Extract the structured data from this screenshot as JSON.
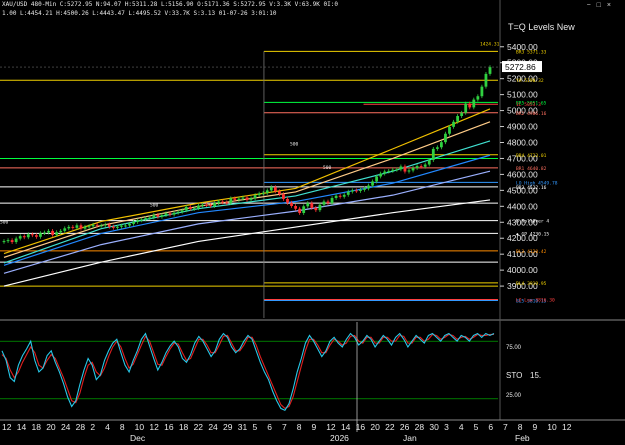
{
  "header": {
    "line1": "XAU/USD 480-Min  C:5272.95 N:94.07 H:5311.28 L:5156.90 O:5171.36 S:5272.95 V:3.3K V:63.9K 0I:0",
    "line2": "1.00  L:4454.21 H:4500.26 L:4443.47 L:4495.52 V:33.7K S:3.13 01-07-26 3:01:10"
  },
  "window_icons": [
    "minimize-icon",
    "restore-icon",
    "close-icon"
  ],
  "colors": {
    "background": "#000000",
    "price_box": "#ffffff",
    "level_resistance": "#ff7060",
    "level_support": "#3399ff",
    "osc_fast": "#27c8e8",
    "osc_slow": "#e02020"
  },
  "chart_data": {
    "type": "line",
    "title": "T=Q Levels New",
    "symbol": "XAU/USD",
    "interval": "480-Min",
    "last_price": 5272.95,
    "last_price_label": "5272.86",
    "ylim": [
      3700,
      5480
    ],
    "y_ticks": [
      3900,
      4000,
      4100,
      4200,
      4300,
      4400,
      4500,
      4600,
      4700,
      4800,
      4900,
      5000,
      5100,
      5200,
      5300,
      5400
    ],
    "y_tick_labels": [
      "3900.00",
      "4000.00",
      "4100.00",
      "4200.00",
      "4300.00",
      "4400.00",
      "4500.00",
      "4600.00",
      "4700.00",
      "4800.00",
      "4900.00",
      "5000.00",
      "5100.00",
      "5200.00",
      "5300.00",
      "5400.00"
    ],
    "x_tick_labels": [
      "12",
      "14",
      "18",
      "20",
      "24",
      "28",
      "2",
      "4",
      "8",
      "10",
      "12",
      "16",
      "18",
      "22",
      "24",
      "29",
      "31",
      "5",
      "6",
      "7",
      "8",
      "9",
      "12",
      "14",
      "16",
      "20",
      "22",
      "26",
      "28",
      "30",
      "3",
      "4",
      "5",
      "6",
      "7",
      "8",
      "9",
      "10",
      "12"
    ],
    "x_months": [
      "Dec",
      "2026",
      "Jan",
      "Feb"
    ],
    "price_close": [
      4182,
      4188,
      4176,
      4198,
      4213,
      4206,
      4225,
      4219,
      4209,
      4232,
      4236,
      4246,
      4221,
      4238,
      4246,
      4262,
      4271,
      4265,
      4281,
      4260,
      4272,
      4275,
      4284,
      4278,
      4280,
      4286,
      4272,
      4265,
      4272,
      4279,
      4280,
      4290,
      4302,
      4312,
      4318,
      4326,
      4330,
      4346,
      4335,
      4345,
      4356,
      4348,
      4360,
      4366,
      4375,
      4396,
      4384,
      4388,
      4405,
      4410,
      4408,
      4402,
      4420,
      4430,
      4425,
      4420,
      4450,
      4440,
      4448,
      4455,
      4440,
      4450,
      4470,
      4480,
      4484,
      4500,
      4520,
      4494,
      4476,
      4446,
      4422,
      4402,
      4385,
      4358,
      4400,
      4420,
      4390,
      4376,
      4410,
      4430,
      4420,
      4452,
      4466,
      4460,
      4472,
      4492,
      4500,
      4496,
      4503,
      4512,
      4530,
      4556,
      4587,
      4605,
      4618,
      4622,
      4629,
      4632,
      4650,
      4618,
      4625,
      4640,
      4652,
      4648,
      4662,
      4690,
      4760,
      4770,
      4802,
      4855,
      4898,
      4930,
      4966,
      4986,
      5044,
      5020,
      5069,
      5090,
      5150,
      5230,
      5272
    ],
    "moving_averages": [
      {
        "color": "#f0c000",
        "values": [
          4104,
          4305,
          4420,
          4512,
          4760,
          5010
        ]
      },
      {
        "color": "#ffcc88",
        "values": [
          4080,
          4280,
          4400,
          4490,
          4700,
          4930
        ]
      },
      {
        "color": "#40e0d0",
        "values": [
          4045,
          4260,
          4385,
          4465,
          4620,
          4810
        ]
      },
      {
        "color": "#2288ff",
        "values": [
          4030,
          4230,
          4360,
          4430,
          4545,
          4720
        ]
      },
      {
        "color": "#9bb0ff",
        "values": [
          3980,
          4160,
          4290,
          4370,
          4470,
          4620
        ]
      },
      {
        "color": "#ffffff",
        "values": [
          3900,
          4050,
          4180,
          4270,
          4360,
          4440
        ]
      }
    ],
    "levels": [
      {
        "label": "BR3 5371.33",
        "value": 5371.33,
        "color": "#f0d000",
        "start": 0.53
      },
      {
        "label": "YH 5190.32",
        "value": 5190.32,
        "color": "#f0d000",
        "start": 0.0
      },
      {
        "label": "BR5 5051.65",
        "value": 5051.65,
        "color": "#00ff40",
        "start": 0.53
      },
      {
        "label": "1L 5053.3",
        "value": 5040,
        "color": "#ff4040",
        "start": 0.73
      },
      {
        "label": "BR2 4986.16",
        "value": 4986.16,
        "color": "#ff7060",
        "start": 0.53
      },
      {
        "label": "BR4 4723.01",
        "value": 4723.01,
        "color": "#f0d000",
        "start": 0.53
      },
      {
        "label": "BR1 4640.82",
        "value": 4640.82,
        "color": "#ff7060",
        "start": 0.0
      },
      {
        "label": "LO High 4549.78",
        "value": 4549.78,
        "color": "#3399ff",
        "start": 0.53
      },
      {
        "label": "BR3 4522.16",
        "value": 4522.16,
        "color": "#ffffff",
        "start": 0.0
      },
      {
        "label": "",
        "value": 4420,
        "color": "#ffffff",
        "start": 0.0
      },
      {
        "label": "B RollOver 4",
        "value": 4310,
        "color": "#ffffff",
        "start": 0.0
      },
      {
        "label": "◆ GP 4230.15",
        "value": 4230.15,
        "color": "#ffffff",
        "start": 0.0
      },
      {
        "label": "BL3 4120.42",
        "value": 4120.42,
        "color": "#ff8c00",
        "start": 0.0
      },
      {
        "label": "",
        "value": 4050,
        "color": "#ffffff",
        "start": 0.0
      },
      {
        "label": "BL4 3919.95",
        "value": 3919.95,
        "color": "#f0d000",
        "start": 0.53
      },
      {
        "label": "BL5 3810.15",
        "value": 3810,
        "color": "#3399ff",
        "start": 0.53
      },
      {
        "label": "LO Low 3816.30",
        "value": 3816.3,
        "color": "#ff4040",
        "start": 0.53
      },
      {
        "label": "",
        "value": 4700,
        "color": "#00ff40",
        "start": 0.0
      },
      {
        "label": "",
        "value": 3900,
        "color": "#f0d000",
        "start": 0.0
      }
    ],
    "left_labels": [
      {
        "text": "500",
        "value": 4780
      },
      {
        "text": "500",
        "value": 4635
      },
      {
        "text": "500",
        "value": 4400
      },
      {
        "text": "500",
        "value": 4293
      }
    ],
    "top_label": "1424.31",
    "oscillator": {
      "name": "STO",
      "value_label": "15.",
      "ylim": [
        0,
        100
      ],
      "ticks": [
        25,
        75
      ],
      "tick_labels": [
        "25.00",
        "75.00"
      ],
      "bands": [
        20,
        80
      ],
      "fast": [
        70,
        60,
        42,
        38,
        55,
        65,
        72,
        80,
        60,
        48,
        52,
        65,
        70,
        58,
        48,
        36,
        22,
        12,
        18,
        35,
        50,
        62,
        55,
        40,
        45,
        60,
        70,
        78,
        82,
        68,
        55,
        48,
        60,
        70,
        82,
        88,
        75,
        62,
        50,
        58,
        68,
        75,
        80,
        74,
        62,
        58,
        66,
        78,
        85,
        80,
        72,
        64,
        70,
        82,
        88,
        84,
        74,
        68,
        72,
        80,
        86,
        82,
        70,
        58,
        48,
        40,
        28,
        18,
        10,
        8,
        15,
        30,
        48,
        62,
        78,
        86,
        80,
        72,
        64,
        70,
        80,
        84,
        78,
        74,
        82,
        88,
        84,
        76,
        80,
        86,
        82,
        74,
        80,
        86,
        82,
        76,
        84,
        88,
        82,
        74,
        80,
        86,
        82,
        78,
        86,
        88,
        84,
        80,
        86,
        88,
        84,
        80,
        86,
        84,
        80,
        86,
        88,
        84,
        88,
        86,
        88
      ],
      "slow": [
        66,
        62,
        50,
        42,
        48,
        58,
        66,
        74,
        68,
        55,
        52,
        60,
        66,
        62,
        52,
        42,
        30,
        18,
        16,
        26,
        42,
        55,
        58,
        48,
        44,
        52,
        64,
        74,
        80,
        74,
        62,
        52,
        56,
        66,
        76,
        85,
        80,
        68,
        56,
        55,
        64,
        72,
        78,
        77,
        68,
        60,
        62,
        72,
        82,
        82,
        76,
        68,
        68,
        76,
        85,
        86,
        78,
        70,
        70,
        76,
        84,
        84,
        76,
        64,
        54,
        44,
        34,
        24,
        14,
        10,
        12,
        22,
        38,
        54,
        70,
        82,
        82,
        76,
        68,
        68,
        76,
        82,
        80,
        76,
        78,
        85,
        86,
        80,
        78,
        84,
        84,
        78,
        78,
        84,
        84,
        80,
        80,
        86,
        85,
        78,
        78,
        84,
        84,
        80,
        82,
        87,
        86,
        82,
        84,
        87,
        86,
        82,
        84,
        85,
        82,
        84,
        87,
        86,
        86,
        87,
        87
      ]
    }
  }
}
